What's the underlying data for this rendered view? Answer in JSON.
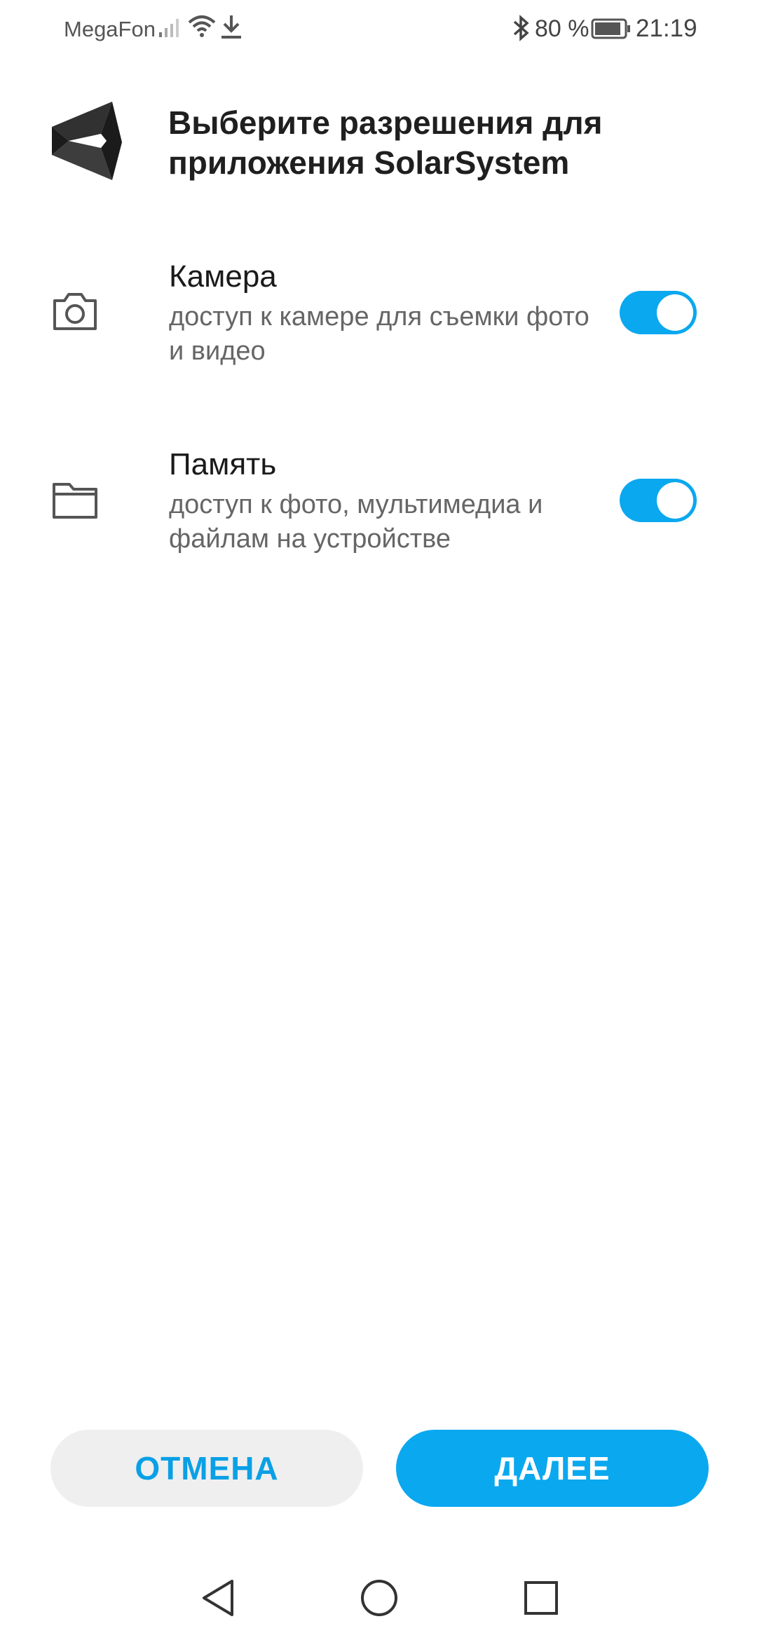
{
  "status_bar": {
    "carrier": "MegaFon",
    "battery_percent": "80 %",
    "time": "21:19",
    "icons": [
      "signal-icon",
      "wifi-icon",
      "download-icon",
      "bluetooth-icon",
      "battery-icon"
    ]
  },
  "header": {
    "title_prefix": "Выберите разрешения для приложения ",
    "app_name": "SolarSystem",
    "logo_icon": "unity-logo-icon"
  },
  "permissions": [
    {
      "title": "Камера",
      "description": "доступ к камере для съемки фото и видео",
      "icon": "camera-icon",
      "enabled": true
    },
    {
      "title": "Память",
      "description": "доступ к фото, мультимедиа и файлам на устройстве",
      "icon": "folder-icon",
      "enabled": true
    }
  ],
  "buttons": {
    "cancel_label": "ОТМЕНА",
    "next_label": "ДАЛЕЕ"
  },
  "colors": {
    "accent": "#0aa8ef",
    "cancel_bg": "#efefef"
  },
  "nav_bar": {
    "icons": [
      "back-icon",
      "home-icon",
      "recents-icon"
    ]
  }
}
